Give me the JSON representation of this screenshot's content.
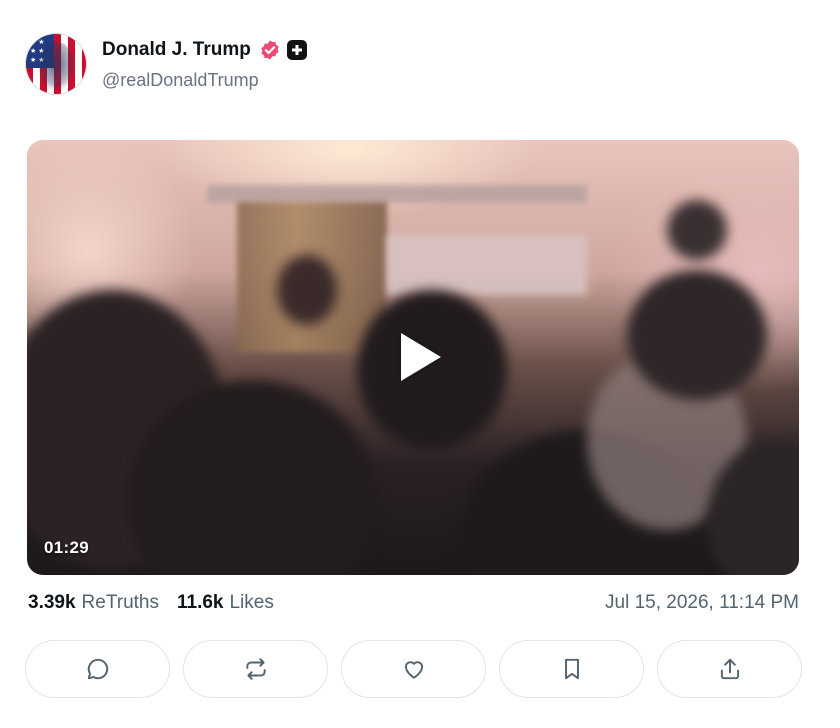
{
  "author": {
    "display_name": "Donald J. Trump",
    "handle": "@realDonaldTrump",
    "verified_icon": "verified-badge-icon",
    "plus_icon": "plus-square-icon",
    "verified_color": "#ec4b73"
  },
  "media": {
    "type": "video",
    "duration": "01:29",
    "play_icon": "play-icon"
  },
  "stats": {
    "retruths_count": "3.39k",
    "retruths_label": "ReTruths",
    "likes_count": "11.6k",
    "likes_label": "Likes",
    "timestamp": "Jul 15, 2026, 11:14 PM"
  },
  "actions": [
    {
      "name": "reply",
      "icon": "comment-icon"
    },
    {
      "name": "retruth",
      "icon": "repost-icon"
    },
    {
      "name": "like",
      "icon": "heart-icon"
    },
    {
      "name": "bookmark",
      "icon": "bookmark-icon"
    },
    {
      "name": "share",
      "icon": "share-icon"
    }
  ],
  "colors": {
    "text_primary": "#0f1419",
    "text_secondary": "#536471",
    "border": "#e1e4e8"
  }
}
